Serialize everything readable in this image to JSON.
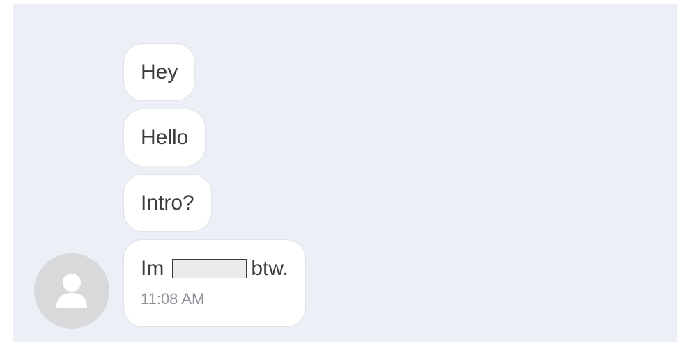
{
  "chat": {
    "messages": [
      {
        "text": "Hey"
      },
      {
        "text": "Hello"
      },
      {
        "text": "Intro?"
      },
      {
        "text_before": "Im",
        "text_after": "btw.",
        "time": "11:08 AM"
      }
    ]
  },
  "colors": {
    "panel_bg": "#eceff5",
    "bubble_bg": "#ffffff",
    "bubble_border": "#dfe2e7",
    "text": "#3c3c3c",
    "timestamp": "#8c8f96",
    "avatar_bg": "#d8d9db"
  },
  "icons": {
    "avatar": "user-icon"
  }
}
